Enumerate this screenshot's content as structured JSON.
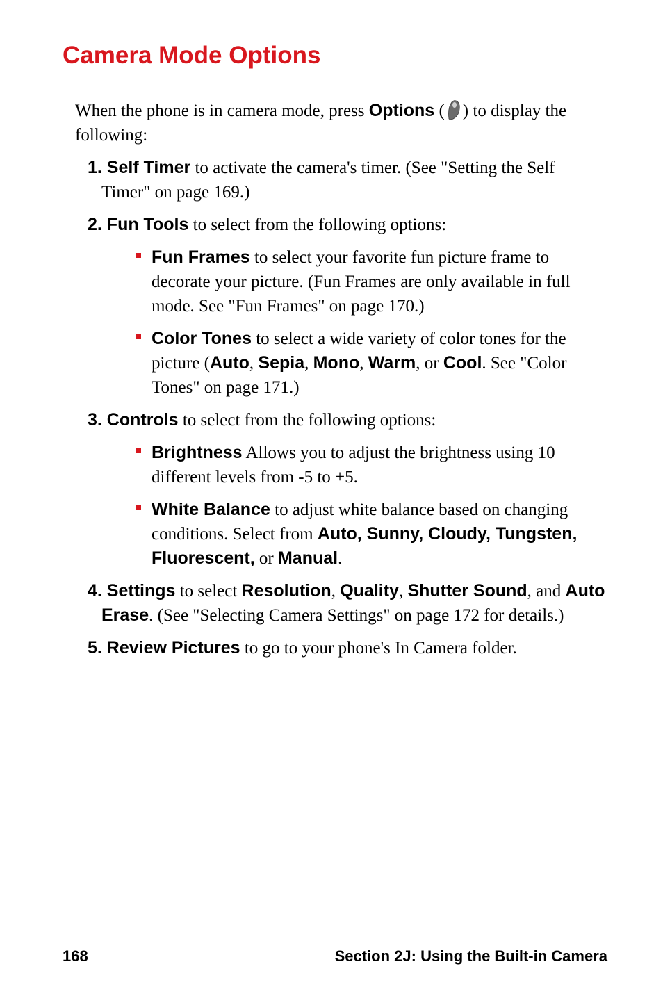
{
  "title": "Camera Mode Options",
  "intro": {
    "prefix": "When the phone is in camera mode, press ",
    "options_label": "Options",
    "paren_open": " (",
    "paren_close": ") to display the following:"
  },
  "items": {
    "one": {
      "num": "1. ",
      "label": "Self Timer",
      "rest": " to activate the camera's timer. (See \"Setting the Self Timer\" on page 169.)"
    },
    "two": {
      "num": "2. ",
      "label": "Fun Tools",
      "rest": " to select from the following options:",
      "sub": {
        "a": {
          "label": "Fun Frames",
          "rest": " to select your favorite fun picture frame to decorate your picture. (Fun Frames are only available in full mode. See \"Fun Frames\" on page 170.)"
        },
        "b": {
          "label": "Color Tones",
          "rest_pre": " to select a wide variety of color tones for the picture (",
          "auto": "Auto",
          "c1": ", ",
          "sepia": "Sepia",
          "c2": ", ",
          "mono": "Mono",
          "c3": ", ",
          "warm": "Warm",
          "c4": ", or ",
          "cool": "Cool",
          "rest_post": ". See \"Color Tones\" on page 171.)"
        }
      }
    },
    "three": {
      "num": "3. ",
      "label": "Controls",
      "rest": " to select from the following options:",
      "sub": {
        "a": {
          "label": "Brightness",
          "rest": " Allows you to adjust the brightness using 10 different levels from -5 to +5."
        },
        "b": {
          "label": "White Balance",
          "rest_pre": " to adjust white balance based on changing conditions. Select from ",
          "opts": "Auto, Sunny, Cloudy, Tungsten, Fluorescent,",
          "or": " or ",
          "manual": "Manual",
          "dot": "."
        }
      }
    },
    "four": {
      "num": "4. ",
      "label": "Settings",
      "rest_pre": " to select ",
      "resolution": "Resolution",
      "c1": ", ",
      "quality": "Quality",
      "c2": ", ",
      "shutter": "Shutter Sound",
      "c3": ", and ",
      "erase": "Auto Erase",
      "rest_post": ". (See \"Selecting Camera Settings\" on page 172 for details.)"
    },
    "five": {
      "num": "5. ",
      "label": "Review Pictures",
      "rest": " to go to your phone's In Camera folder."
    }
  },
  "footer": {
    "page": "168",
    "section": "Section 2J: Using the Built-in Camera"
  }
}
